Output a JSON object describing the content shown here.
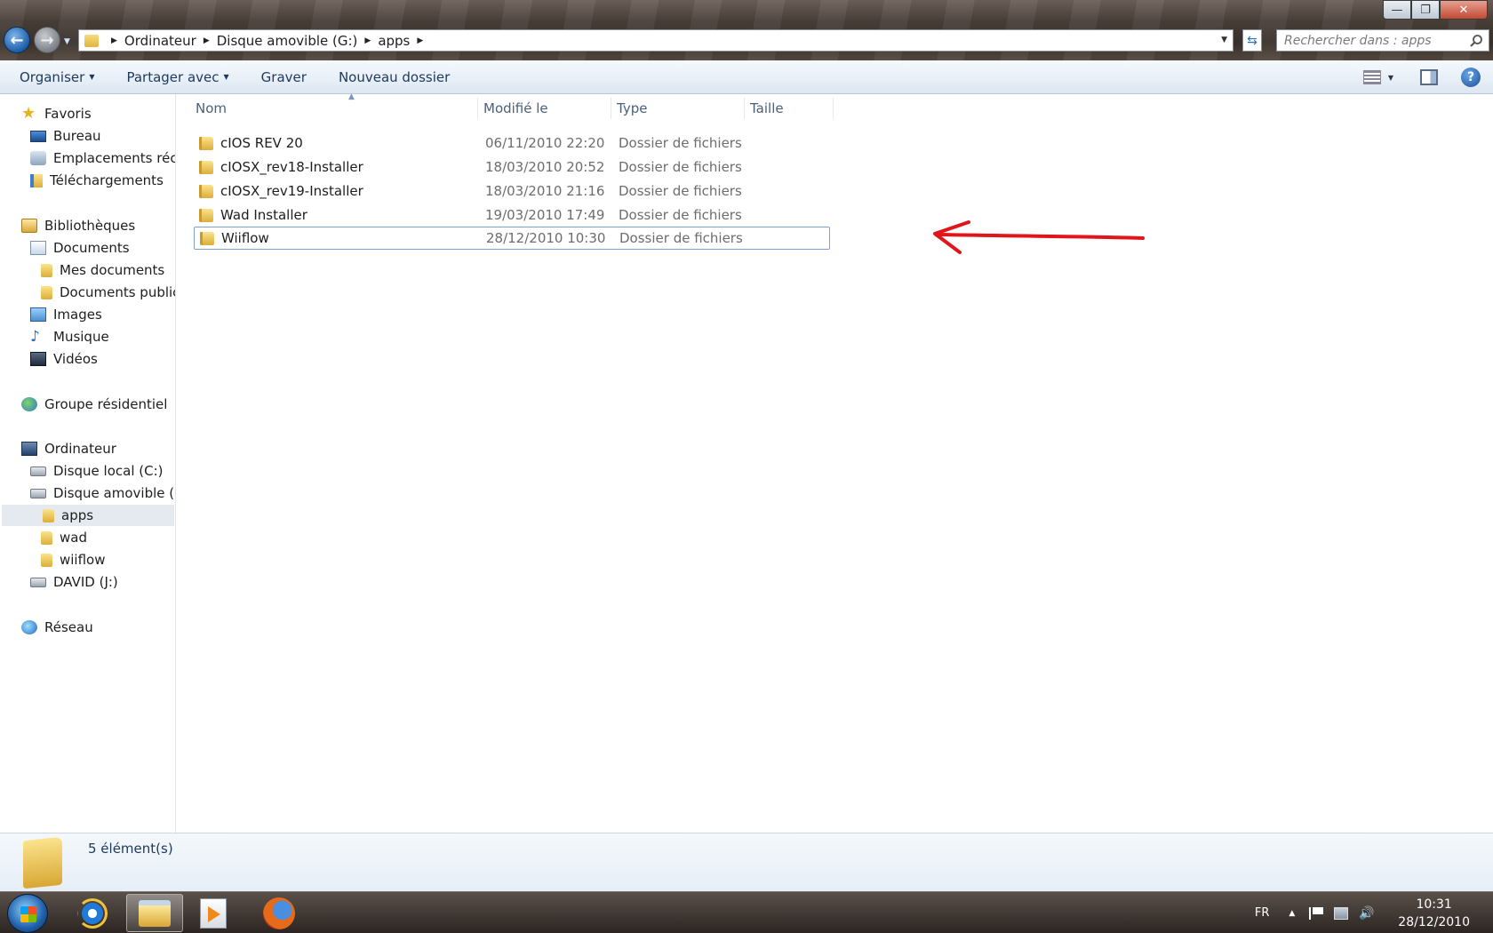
{
  "window": {
    "controls": {
      "minimize": "—",
      "maximize": "❐",
      "close": "✕"
    }
  },
  "address_bar": {
    "crumbs": [
      "Ordinateur",
      "Disque amovible (G:)",
      "apps"
    ],
    "search_placeholder": "Rechercher dans : apps"
  },
  "command_bar": {
    "organize": "Organiser",
    "share": "Partager avec",
    "burn": "Graver",
    "new_folder": "Nouveau dossier",
    "help": "?"
  },
  "nav_pane": {
    "favorites": "Favoris",
    "desktop": "Bureau",
    "recent": "Emplacements récen",
    "downloads": "Téléchargements",
    "libraries": "Bibliothèques",
    "documents": "Documents",
    "my_documents": "Mes documents",
    "public_documents": "Documents publics",
    "images": "Images",
    "music": "Musique",
    "videos": "Vidéos",
    "homegroup": "Groupe résidentiel",
    "computer": "Ordinateur",
    "local_disk": "Disque local (C:)",
    "removable_disk": "Disque amovible (G:)",
    "apps": "apps",
    "wad": "wad",
    "wiiflow": "wiiflow",
    "david": "DAVID (J:)",
    "network": "Réseau"
  },
  "columns": {
    "name": "Nom",
    "modified": "Modifié le",
    "type": "Type",
    "size": "Taille"
  },
  "files": [
    {
      "name": "cIOS REV 20",
      "modified": "06/11/2010 22:20",
      "type": "Dossier de fichiers"
    },
    {
      "name": "cIOSX_rev18-Installer",
      "modified": "18/03/2010 20:52",
      "type": "Dossier de fichiers"
    },
    {
      "name": "cIOSX_rev19-Installer",
      "modified": "18/03/2010 21:16",
      "type": "Dossier de fichiers"
    },
    {
      "name": "Wad Installer",
      "modified": "19/03/2010 17:49",
      "type": "Dossier de fichiers"
    },
    {
      "name": "Wiiflow",
      "modified": "28/12/2010 10:30",
      "type": "Dossier de fichiers"
    }
  ],
  "details": {
    "count": "5 élément(s)"
  },
  "taskbar": {
    "language": "FR",
    "time": "10:31",
    "date": "28/12/2010"
  },
  "colors": {
    "annotation": "#e0161b",
    "accent": "#1e395b",
    "selection": "#e5eaf0"
  }
}
